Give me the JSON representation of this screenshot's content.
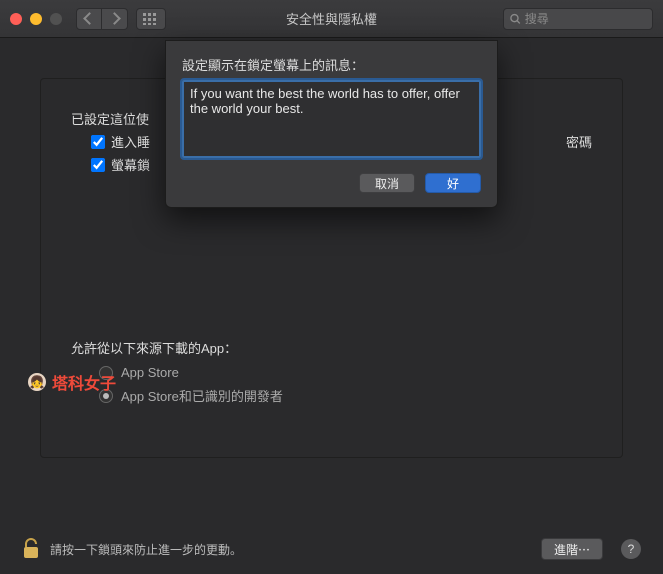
{
  "window": {
    "title": "安全性與隱私權",
    "search_placeholder": "搜尋"
  },
  "panel": {
    "configured_label_partial": "已設定這位使",
    "checkbox1_label_partial": "進入睡",
    "checkbox2_label_partial": "螢幕鎖",
    "right_text_partial": "密碼",
    "allow_label": "允許從以下來源下載的App：",
    "radio1": "App Store",
    "radio2": "App Store和已識別的開發者"
  },
  "modal": {
    "label": "設定顯示在鎖定螢幕上的訊息：",
    "textarea_value": "If you want the best the world has to offer, offer the world your best.",
    "cancel": "取消",
    "ok": "好"
  },
  "watermark": {
    "text": "塔科女子"
  },
  "footer": {
    "lock_text": "請按一下鎖頭來防止進一步的更動。",
    "advanced": "進階⋯",
    "help": "?"
  }
}
